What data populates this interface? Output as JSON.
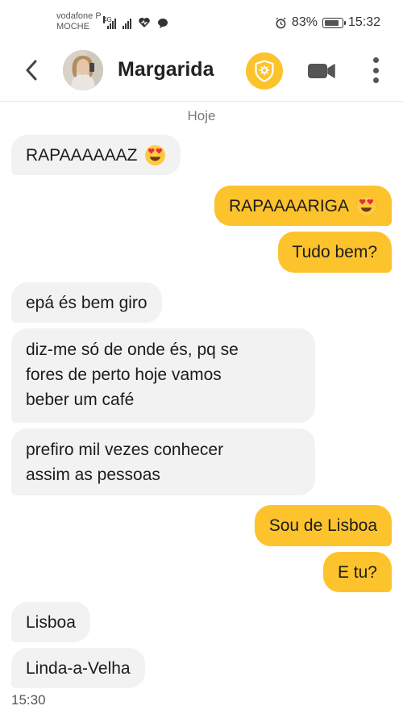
{
  "status": {
    "carrier_line1": "vodafone P",
    "carrier_line2": "MOCHE",
    "net_badge": "4G",
    "battery": "83%",
    "battery_level": 0.83,
    "clock": "15:32"
  },
  "header": {
    "contact_name": "Margarida"
  },
  "chat": {
    "day": "Hoje",
    "messages": [
      {
        "dir": "in",
        "text": "RAPAAAAAAZ",
        "emoji": "heart-eyes"
      },
      {
        "dir": "out",
        "text": "RAPAAAARIGA",
        "emoji": "heart-eyes"
      },
      {
        "dir": "out",
        "text": "Tudo bem?"
      },
      {
        "dir": "in",
        "text": "epá és bem giro"
      },
      {
        "dir": "in",
        "lines": [
          "diz-me só de onde és, pq se",
          "fores de perto hoje vamos",
          "beber um café"
        ]
      },
      {
        "dir": "in",
        "lines": [
          "prefiro mil vezes conhecer",
          "assim as pessoas"
        ]
      },
      {
        "dir": "out",
        "text": "Sou de Lisboa"
      },
      {
        "dir": "out",
        "text": "E tu?"
      },
      {
        "dir": "in",
        "text": "Lisboa"
      },
      {
        "dir": "in",
        "text": "Linda-a-Velha"
      }
    ],
    "last_time": "15:30"
  },
  "colors": {
    "accent": "#fcc32c",
    "incoming_bubble": "#f2f2f2",
    "text": "#1c1c1c"
  }
}
